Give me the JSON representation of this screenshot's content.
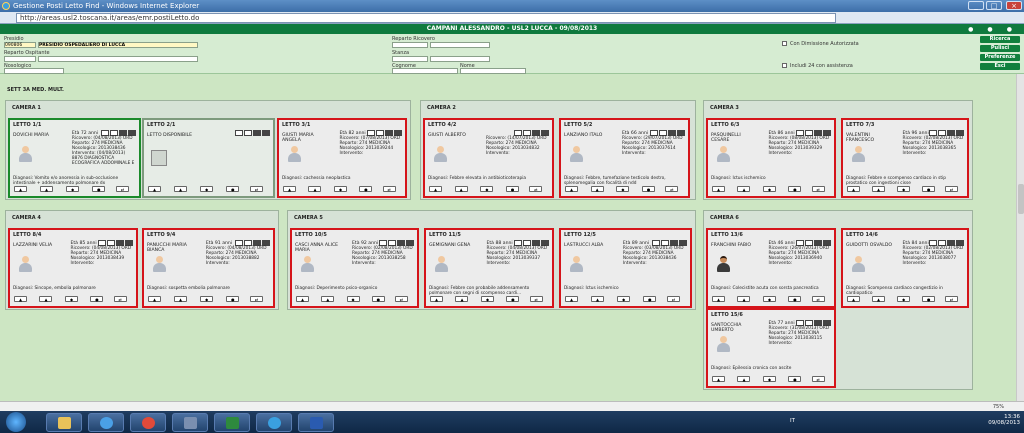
{
  "window": {
    "title": "Gestione Posti Letto Find - Windows Internet Explorer",
    "url": "http://areas.usl2.toscana.it/areas/emr.postiLetto.do"
  },
  "header": {
    "user_date": "CAMPANI ALESSANDRO - USL2 LUCCA - 09/08/2013"
  },
  "filters": {
    "presidio_label": "Presidio",
    "presidio_code": "090806",
    "presidio_value": "PRESIDIO OSPEDALIERO DI LUCCA",
    "reparto_ospitante_label": "Reparto Ospitante",
    "reparto_ricovero_label": "Reparto Ricovero",
    "nosologico_label": "Nosologico",
    "stanza_label": "Stanza",
    "cognome_label": "Cognome",
    "nome_label": "Nome",
    "dimissione_label": "Con Dimissione Autorizzata",
    "includi_label": "Includi 24 con assistenza",
    "btn_ricerca": "Ricerca",
    "btn_pulisci": "Pulisci",
    "btn_preferenze": "Preferenze",
    "btn_esci": "Esci"
  },
  "section": {
    "title": "SETT 3A MED. MULT."
  },
  "rooms": [
    {
      "label": "CAMERA 1"
    },
    {
      "label": "CAMERA 2"
    },
    {
      "label": "CAMERA 3"
    },
    {
      "label": "CAMERA 4"
    },
    {
      "label": "CAMERA 5"
    },
    {
      "label": "CAMERA 6"
    }
  ],
  "beds": [
    {
      "id": "LETTO 1/1",
      "name": "DOVICHI MARIA",
      "age": "Età 72 anni",
      "ricovero": "Ricovero: (04/08/2013) ORD",
      "reparto": "Reparto: 274 MEDICINA",
      "nosologico": "Nosologico: 2013038436",
      "intervento": "Intervento: (04/08/2013)",
      "extra": "8876 DIAGNOSTICA ECOGRAFICA ADDOMINALE E",
      "diag": "Diagnosi: Vomito e/o anoressia in sub-occlusione intestinale + addensamento polmonare dx"
    },
    {
      "id": "LETTO 2/1",
      "name": "LETTO DISPONIBILE",
      "age": "",
      "ricovero": "",
      "reparto": "",
      "nosologico": "",
      "intervento": "",
      "extra": "",
      "diag": ""
    },
    {
      "id": "LETTO 3/1",
      "name": "GIUSTI MARIA ANGELA",
      "age": "Età 82 anni",
      "ricovero": "Ricovero: (07/08/2013) ORD",
      "reparto": "Reparto: 274 MEDICINA",
      "nosologico": "Nosologico: 2013039244",
      "intervento": "Intervento:",
      "extra": "",
      "diag": "Diagnosi: cachessia neoplastica"
    },
    {
      "id": "LETTO 4/2",
      "name": "GIUSTI ALBERTO",
      "age": "",
      "ricovero": "Ricovero: (14/07/2013) ORD",
      "reparto": "Reparto: 274 MEDICINA",
      "nosologico": "Nosologico: 2013034832",
      "intervento": "Intervento:",
      "extra": "",
      "diag": "Diagnosi: Febbre elevata in antibioticoterapia"
    },
    {
      "id": "LETTO 5/2",
      "name": "LANZIANO ITALO",
      "age": "Età 66 anni",
      "ricovero": "Ricovero: (29/07/2013) ORD",
      "reparto": "Reparto: 274 MEDICINA",
      "nosologico": "Nosologico: 2013037614",
      "intervento": "Intervento:",
      "extra": "",
      "diag": "Diagnosi: Febbre, tumefazione testicolo destro, splenomegalia con focalità di ndd"
    },
    {
      "id": "LETTO 6/3",
      "name": "PASQUINELLI CESARE",
      "age": "Età 86 anni",
      "ricovero": "Ricovero: (08/08/2013) ORD",
      "reparto": "Reparto: 274 MEDICINA",
      "nosologico": "Nosologico: 2013039329",
      "intervento": "Intervento:",
      "extra": "",
      "diag": "Diagnosi: Ictus ischemico"
    },
    {
      "id": "LETTO 7/3",
      "name": "VALENTINI FRANCESCO",
      "age": "Età 96 anni",
      "ricovero": "Ricovero: (02/08/2013) ORD",
      "reparto": "Reparto: 274 MEDICINA",
      "nosologico": "Nosologico: 2013038365",
      "intervento": "Intervento:",
      "extra": "",
      "diag": "Diagnosi: Febbre e scompenso cardiaco in stip prostatico con ingestioni cisse"
    },
    {
      "id": "LETTO 8/4",
      "name": "LAZZARINI VELIA",
      "age": "Età 85 anni",
      "ricovero": "Ricovero: (04/08/2013) ORD",
      "reparto": "Reparto: 274 MEDICINA",
      "nosologico": "Nosologico: 2013038439",
      "intervento": "Intervento:",
      "extra": "",
      "diag": "Diagnosi: Sincope, embolia polmonare"
    },
    {
      "id": "LETTO 9/4",
      "name": "PANUCCHI MARIA BIANCA",
      "age": "Età 91 anni",
      "ricovero": "Ricovero: (04/08/2013) ORD",
      "reparto": "Reparto: 274 MEDICINA",
      "nosologico": "Nosologico: 2013038882",
      "intervento": "Intervento:",
      "extra": "",
      "diag": "Diagnosi: sospetta embolia polmonare"
    },
    {
      "id": "LETTO 10/5",
      "name": "CASCI ANNA ALICE MARIA",
      "age": "Età 92 anni",
      "ricovero": "Ricovero: (02/08/2013) ORD",
      "reparto": "Reparto: 274 MEDICINA",
      "nosologico": "Nosologico: 2013038258",
      "intervento": "Intervento:",
      "extra": "",
      "diag": "Diagnosi: Deperimento psico-organico"
    },
    {
      "id": "LETTO 11/5",
      "name": "GEMIGNANI GENA",
      "age": "Età 88 anni",
      "ricovero": "Ricovero: (04/08/2013) ORD",
      "reparto": "Reparto: 274 MEDICINA",
      "nosologico": "Nosologico: 2013039337",
      "intervento": "Intervento:",
      "extra": "",
      "diag": "Diagnosi: Febbre con probabile addensamento polmonare con segni di scompenso cardi..."
    },
    {
      "id": "LETTO 12/5",
      "name": "LASTRUCCI ALBA",
      "age": "Età 89 anni",
      "ricovero": "Ricovero: (03/08/2013) ORD",
      "reparto": "Reparto: 274 MEDICINA",
      "nosologico": "Nosologico: 2013038436",
      "intervento": "Intervento:",
      "extra": "",
      "diag": "Diagnosi: Ictus ischemico"
    },
    {
      "id": "LETTO 13/6",
      "name": "FRANCHINI FABIO",
      "age": "Età 46 anni",
      "ricovero": "Ricovero: (26/07/2013) ORD",
      "reparto": "Reparto: 274 MEDICINA",
      "nosologico": "Nosologico: 2013036940",
      "intervento": "Intervento:",
      "extra": "",
      "diag": "Diagnosi: Colecistite acuta con sorsta pancreatica"
    },
    {
      "id": "LETTO 14/6",
      "name": "GUIDOTTI OSVALDO",
      "age": "Età 84 anni",
      "ricovero": "Ricovero: (02/08/2013) ORD",
      "reparto": "Reparto: 274 MEDICINA",
      "nosologico": "Nosologico: 2013038077",
      "intervento": "Intervento:",
      "extra": "",
      "diag": "Diagnosi: Scompenso cardiaco congestizio in cardiopatico"
    },
    {
      "id": "LETTO 15/6",
      "name": "SANTOCCHIA UMBERTO",
      "age": "Età 77 anni",
      "ricovero": "Ricovero: (31/08/2013) ORD",
      "reparto": "Reparto: 274 MEDICINA",
      "nosologico": "Nosologico: 2013038115",
      "intervento": "Intervento:",
      "extra": "",
      "diag": "Diagnosi: Epilessia cronica con ascite"
    }
  ],
  "status": {
    "zoom": "75%"
  },
  "tray": {
    "lang": "IT",
    "time": "13:36",
    "date": "09/08/2013"
  }
}
